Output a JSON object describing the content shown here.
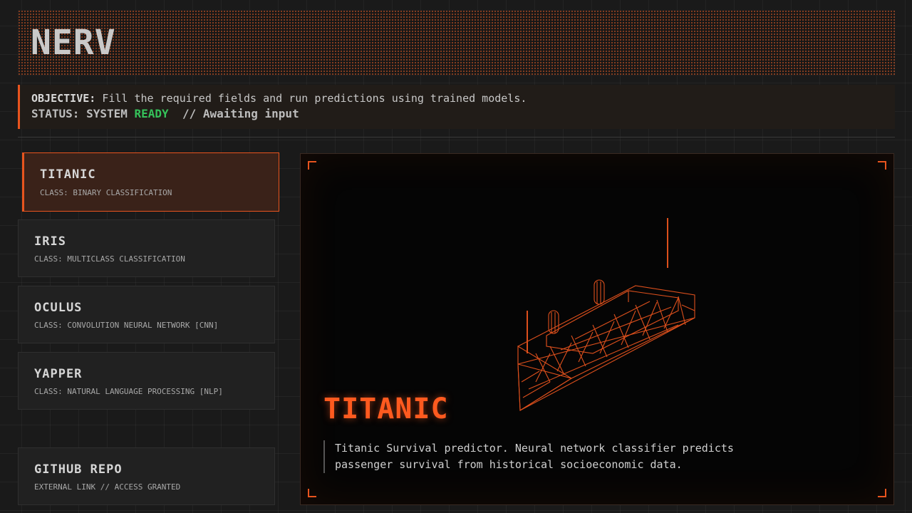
{
  "app": {
    "logo": "NERV"
  },
  "objective": {
    "label": "OBJECTIVE:",
    "text": "Fill the required fields and run predictions using trained models.",
    "status_prefix": "STATUS: SYSTEM",
    "status_value": "READY",
    "status_suffix": "// Awaiting input"
  },
  "models": [
    {
      "name": "TITANIC",
      "class": "CLASS: BINARY CLASSIFICATION",
      "active": true
    },
    {
      "name": "IRIS",
      "class": "CLASS: MULTICLASS CLASSIFICATION",
      "active": false
    },
    {
      "name": "OCULUS",
      "class": "CLASS: CONVOLUTION NEURAL NETWORK [CNN]",
      "active": false
    },
    {
      "name": "YAPPER",
      "class": "CLASS: NATURAL LANGUAGE PROCESSING [NLP]",
      "active": false
    }
  ],
  "github": {
    "name": "GITHUB REPO",
    "class": "EXTERNAL LINK // ACCESS GRANTED"
  },
  "viewer": {
    "title": "TITANIC",
    "description": "Titanic Survival predictor. Neural network classifier predicts passenger survival from historical socioeconomic data.",
    "model_icon": "ship-wireframe-icon"
  },
  "colors": {
    "accent": "#e8541e",
    "ready": "#35c25a",
    "background": "#1a1a1a"
  }
}
